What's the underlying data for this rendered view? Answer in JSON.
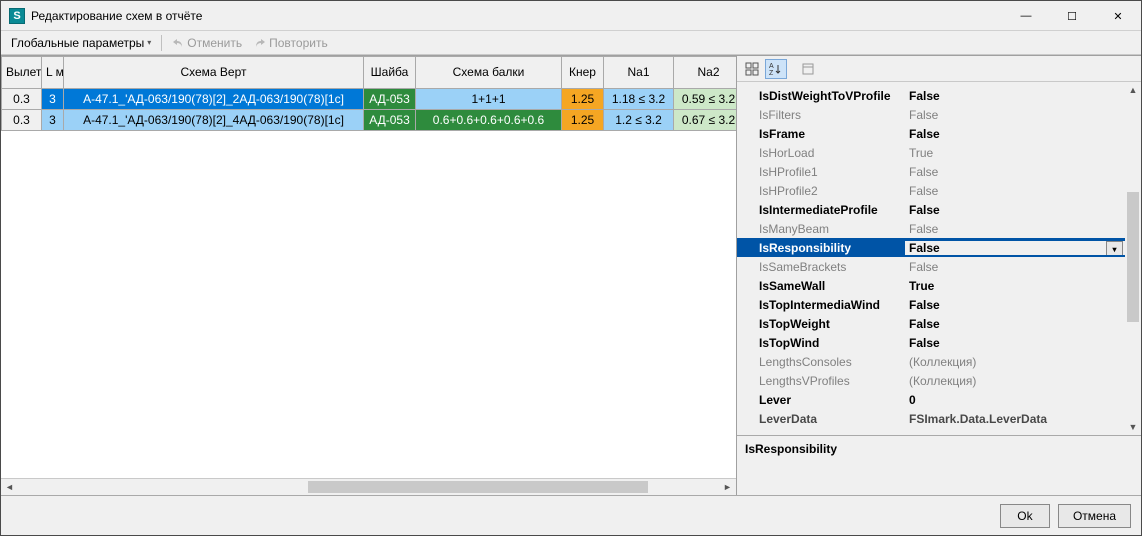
{
  "window": {
    "title": "Редактирование схем в отчёте",
    "app_initial": "S"
  },
  "toolbar": {
    "global_params": "Глобальные параметры",
    "undo": "Отменить",
    "redo": "Повторить"
  },
  "grid": {
    "headers": {
      "vylet": "Вылет м",
      "L": "L м",
      "schv": "Схема Верт",
      "shaiba": "Шайба",
      "schb": "Схема балки",
      "kner": "Кнер",
      "na1": "Na1",
      "na2": "Na2"
    },
    "rows": [
      {
        "vylet": "0.3",
        "L": "3",
        "schv": "А-47.1_'АД-063/190(78)[2]_2АД-063/190(78)[1c]",
        "shaiba": "АД-053",
        "schb": "1+1+1",
        "kner": "1.25",
        "na1": "1.18 ≤ 3.2",
        "na2": "0.59 ≤ 3.2",
        "schb_style": "blue",
        "selected": true
      },
      {
        "vylet": "0.3",
        "L": "3",
        "schv": "А-47.1_'АД-063/190(78)[2]_4АД-063/190(78)[1c]",
        "shaiba": "АД-053",
        "schb": "0.6+0.6+0.6+0.6+0.6",
        "kner": "1.25",
        "na1": "1.2 ≤ 3.2",
        "na2": "0.67 ≤ 3.2",
        "schb_style": "green",
        "selected": false
      }
    ]
  },
  "props": {
    "selected_desc": "IsResponsibility",
    "items": [
      {
        "name": "IsDistWeightToVProfile",
        "value": "False",
        "bold": true
      },
      {
        "name": "IsFilters",
        "value": "False",
        "bold": false
      },
      {
        "name": "IsFrame",
        "value": "False",
        "bold": true
      },
      {
        "name": "IsHorLoad",
        "value": "True",
        "bold": false
      },
      {
        "name": "IsHProfile1",
        "value": "False",
        "bold": false
      },
      {
        "name": "IsHProfile2",
        "value": "False",
        "bold": false
      },
      {
        "name": "IsIntermediateProfile",
        "value": "False",
        "bold": true
      },
      {
        "name": "IsManyBeam",
        "value": "False",
        "bold": false
      },
      {
        "name": "IsResponsibility",
        "value": "False",
        "bold": true,
        "selected": true
      },
      {
        "name": "IsSameBrackets",
        "value": "False",
        "bold": false
      },
      {
        "name": "IsSameWall",
        "value": "True",
        "bold": true
      },
      {
        "name": "IsTopIntermediaWind",
        "value": "False",
        "bold": true
      },
      {
        "name": "IsTopWeight",
        "value": "False",
        "bold": true
      },
      {
        "name": "IsTopWind",
        "value": "False",
        "bold": true
      },
      {
        "name": "LengthsConsoles",
        "value": "(Коллекция)",
        "bold": false
      },
      {
        "name": "LengthsVProfiles",
        "value": "(Коллекция)",
        "bold": false
      },
      {
        "name": "Lever",
        "value": "0",
        "bold": true
      },
      {
        "name": "LeverData",
        "value": "FSImark.Data.LeverData",
        "bold": true,
        "dim": true
      }
    ]
  },
  "footer": {
    "ok": "Ok",
    "cancel": "Отмена"
  }
}
